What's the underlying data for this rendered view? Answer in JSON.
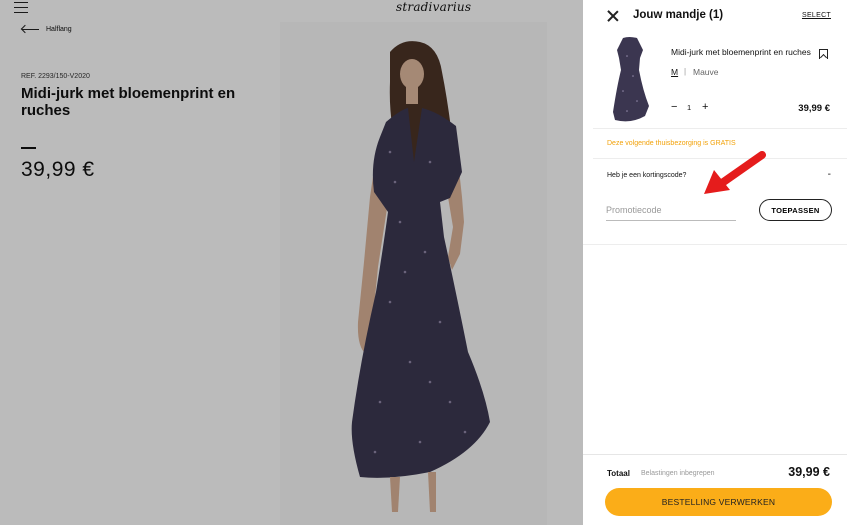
{
  "header": {
    "logo": "stradivarius",
    "back_label": "Halflang"
  },
  "product": {
    "ref": "REF. 2293/150-V2020",
    "title": "Midi-jurk met bloemenprint en ruches",
    "price": "39,99 €"
  },
  "cart": {
    "title": "Jouw mandje (1)",
    "select_label": "SELECT",
    "item": {
      "name": "Midi-jurk met bloemenprint en ruches",
      "size": "M",
      "separator": "|",
      "color": "Mauve",
      "minus": "−",
      "quantity": "1",
      "plus": "+",
      "price": "39,99 €"
    },
    "shipping_note": "Deze volgende thuisbezorging is GRATIS",
    "promo": {
      "question": "Heb je een kortingscode?",
      "toggle": "-",
      "placeholder": "Promotiecode",
      "value": "",
      "apply_label": "TOEPASSEN"
    },
    "total": {
      "label": "Totaal",
      "tax_note": "Belastingen inbegrepen",
      "amount": "39,99 €"
    },
    "checkout_label": "BESTELLING VERWERKEN"
  },
  "colors": {
    "accent": "#fbad18",
    "shipping_text": "#f2a20a",
    "annotation_arrow": "#e51c1c",
    "dress": "#3b3650"
  },
  "icons": [
    "menu-icon",
    "back-arrow-icon",
    "close-icon",
    "bookmark-icon",
    "annotation-arrow"
  ]
}
